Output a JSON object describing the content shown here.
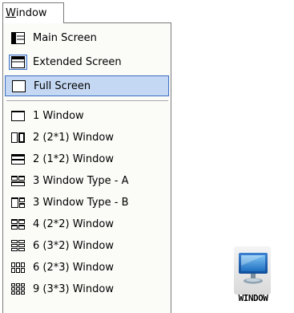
{
  "menu": {
    "title_accel": "W",
    "title_rest": "indow",
    "items": [
      {
        "label": "Main Screen",
        "icon": "main-screen-icon"
      },
      {
        "label": "Extended Screen",
        "icon": "extended-screen-icon"
      },
      {
        "label": "Full Screen",
        "icon": "full-screen-icon"
      },
      {
        "label": "1 Window",
        "icon": "one-window-icon"
      },
      {
        "label": "2 (2*1) Window",
        "icon": "two-by-one-window-icon"
      },
      {
        "label": "2 (1*2) Window",
        "icon": "one-by-two-window-icon"
      },
      {
        "label": "3 Window Type - A",
        "icon": "three-window-type-a-icon"
      },
      {
        "label": "3 Window Type - B",
        "icon": "three-window-type-b-icon"
      },
      {
        "label": "4 (2*2) Window",
        "icon": "four-window-icon"
      },
      {
        "label": "6 (3*2) Window",
        "icon": "six-window-3x2-icon"
      },
      {
        "label": "6 (2*3) Window",
        "icon": "six-window-2x3-icon"
      },
      {
        "label": "9 (3*3) Window",
        "icon": "nine-window-icon"
      }
    ]
  },
  "desktop_icon": {
    "label": "WINDOW",
    "icon": "monitor-icon"
  },
  "colors": {
    "highlight_bg": "#c5d8f3",
    "highlight_border": "#3a6fc4",
    "menu_bg": "#fbfbf8"
  }
}
